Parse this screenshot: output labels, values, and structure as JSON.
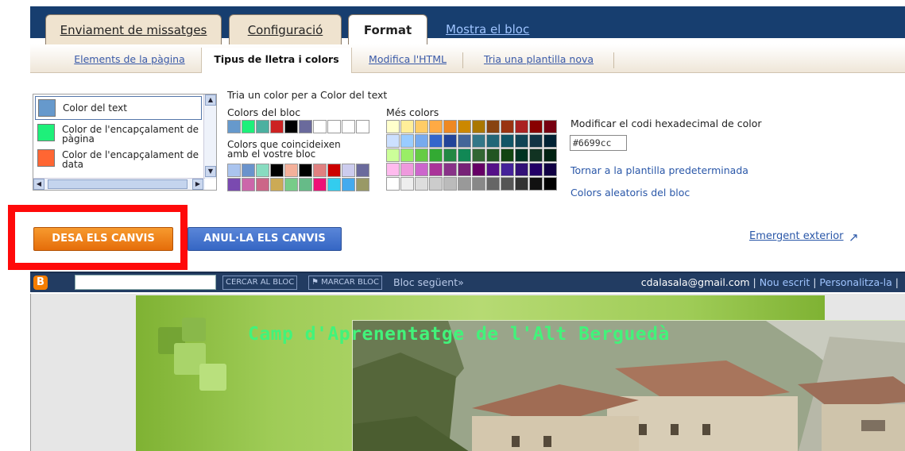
{
  "tabs": {
    "posting": "Enviament de missatges",
    "settings": "Configuració",
    "layout": "Format",
    "view_blog": "Mostra el  bloc"
  },
  "subtabs": {
    "page_elements": "Elements de la pàgina",
    "fonts_colors": "Tipus de lletra i colors",
    "edit_html": "Modifica l'HTML",
    "pick_template": "Tria una plantilla nova"
  },
  "elements_list": [
    {
      "label": "Color del text",
      "color": "#6699cc"
    },
    {
      "label": "Color de l'encapçalament de pàgina",
      "color": "#1ef07a"
    },
    {
      "label": "Color de l'encapçalament de data",
      "color": "#ff6633"
    }
  ],
  "colors": {
    "heading": "Tria un color per a Color del text",
    "blog_colors_label": "Colors del bloc",
    "matching_label": "Colors que coincideixen amb el vostre bloc",
    "more_colors_label": "Més colors",
    "hex_label": "Modificar el codi hexadecimal de color",
    "hex_value": "#6699cc",
    "revert_link": "Tornar a la plantilla predeterminada",
    "random_link": "Colors aleatoris del bloc",
    "blog_palette": [
      "#6699cc",
      "#1ef07a",
      "#4cb0a0",
      "#cc2222",
      "#000000",
      "#6a6a9c",
      "#ffffff",
      "#ffffff",
      "#ffffff",
      "#ffffff"
    ],
    "matching_palette": [
      "#aac4ee",
      "#6a93cc",
      "#88dcc0",
      "#000000",
      "#f4b09a",
      "#000000",
      "#e08080",
      "#cc0000",
      "#ccccee",
      "#6a6a9c",
      "#7a4ab0",
      "#cc66aa",
      "#cc6688",
      "#ccaa55",
      "#77cc88",
      "#66bb88",
      "#ee1177",
      "#33ccee",
      "#44aaee",
      "#999966"
    ],
    "more_palette": [
      "#ffffcc",
      "#ffee99",
      "#ffcc66",
      "#ffaa44",
      "#ee8822",
      "#cc8800",
      "#aa7700",
      "#884411",
      "#993311",
      "#aa2222",
      "#880000",
      "#770011",
      "#cce0ff",
      "#99ccff",
      "#77aaee",
      "#3366cc",
      "#224499",
      "#446699",
      "#337788",
      "#226677",
      "#115566",
      "#114455",
      "#113344",
      "#002233",
      "#ccff99",
      "#99ee66",
      "#66cc44",
      "#33aa33",
      "#228844",
      "#118855",
      "#336633",
      "#225522",
      "#114411",
      "#003322",
      "#113322",
      "#002211",
      "#ffbbee",
      "#ee99dd",
      "#cc66cc",
      "#aa3399",
      "#883388",
      "#772277",
      "#660066",
      "#551188",
      "#442299",
      "#331177",
      "#220066",
      "#110044",
      "#ffffff",
      "#eeeeee",
      "#dddddd",
      "#cccccc",
      "#bbbbbb",
      "#999999",
      "#888888",
      "#666666",
      "#555555",
      "#333333",
      "#111111",
      "#000000"
    ]
  },
  "buttons": {
    "save": "DESA ELS CANVIS",
    "cancel": "ANUL·LA ELS CANVIS",
    "popout": "Emergent exterior"
  },
  "navbar": {
    "search_button": "CERCAR AL BLOC",
    "flag_button": "MARCAR BLOC",
    "next_blog": "Bloc següent»",
    "user": "cdalasala@gmail.com",
    "new_post": "Nou escrit",
    "customize": "Personalitza-la",
    "sep": "|"
  },
  "blog": {
    "title": "Camp d'Aprenentatge de l'Alt Berguedà"
  }
}
